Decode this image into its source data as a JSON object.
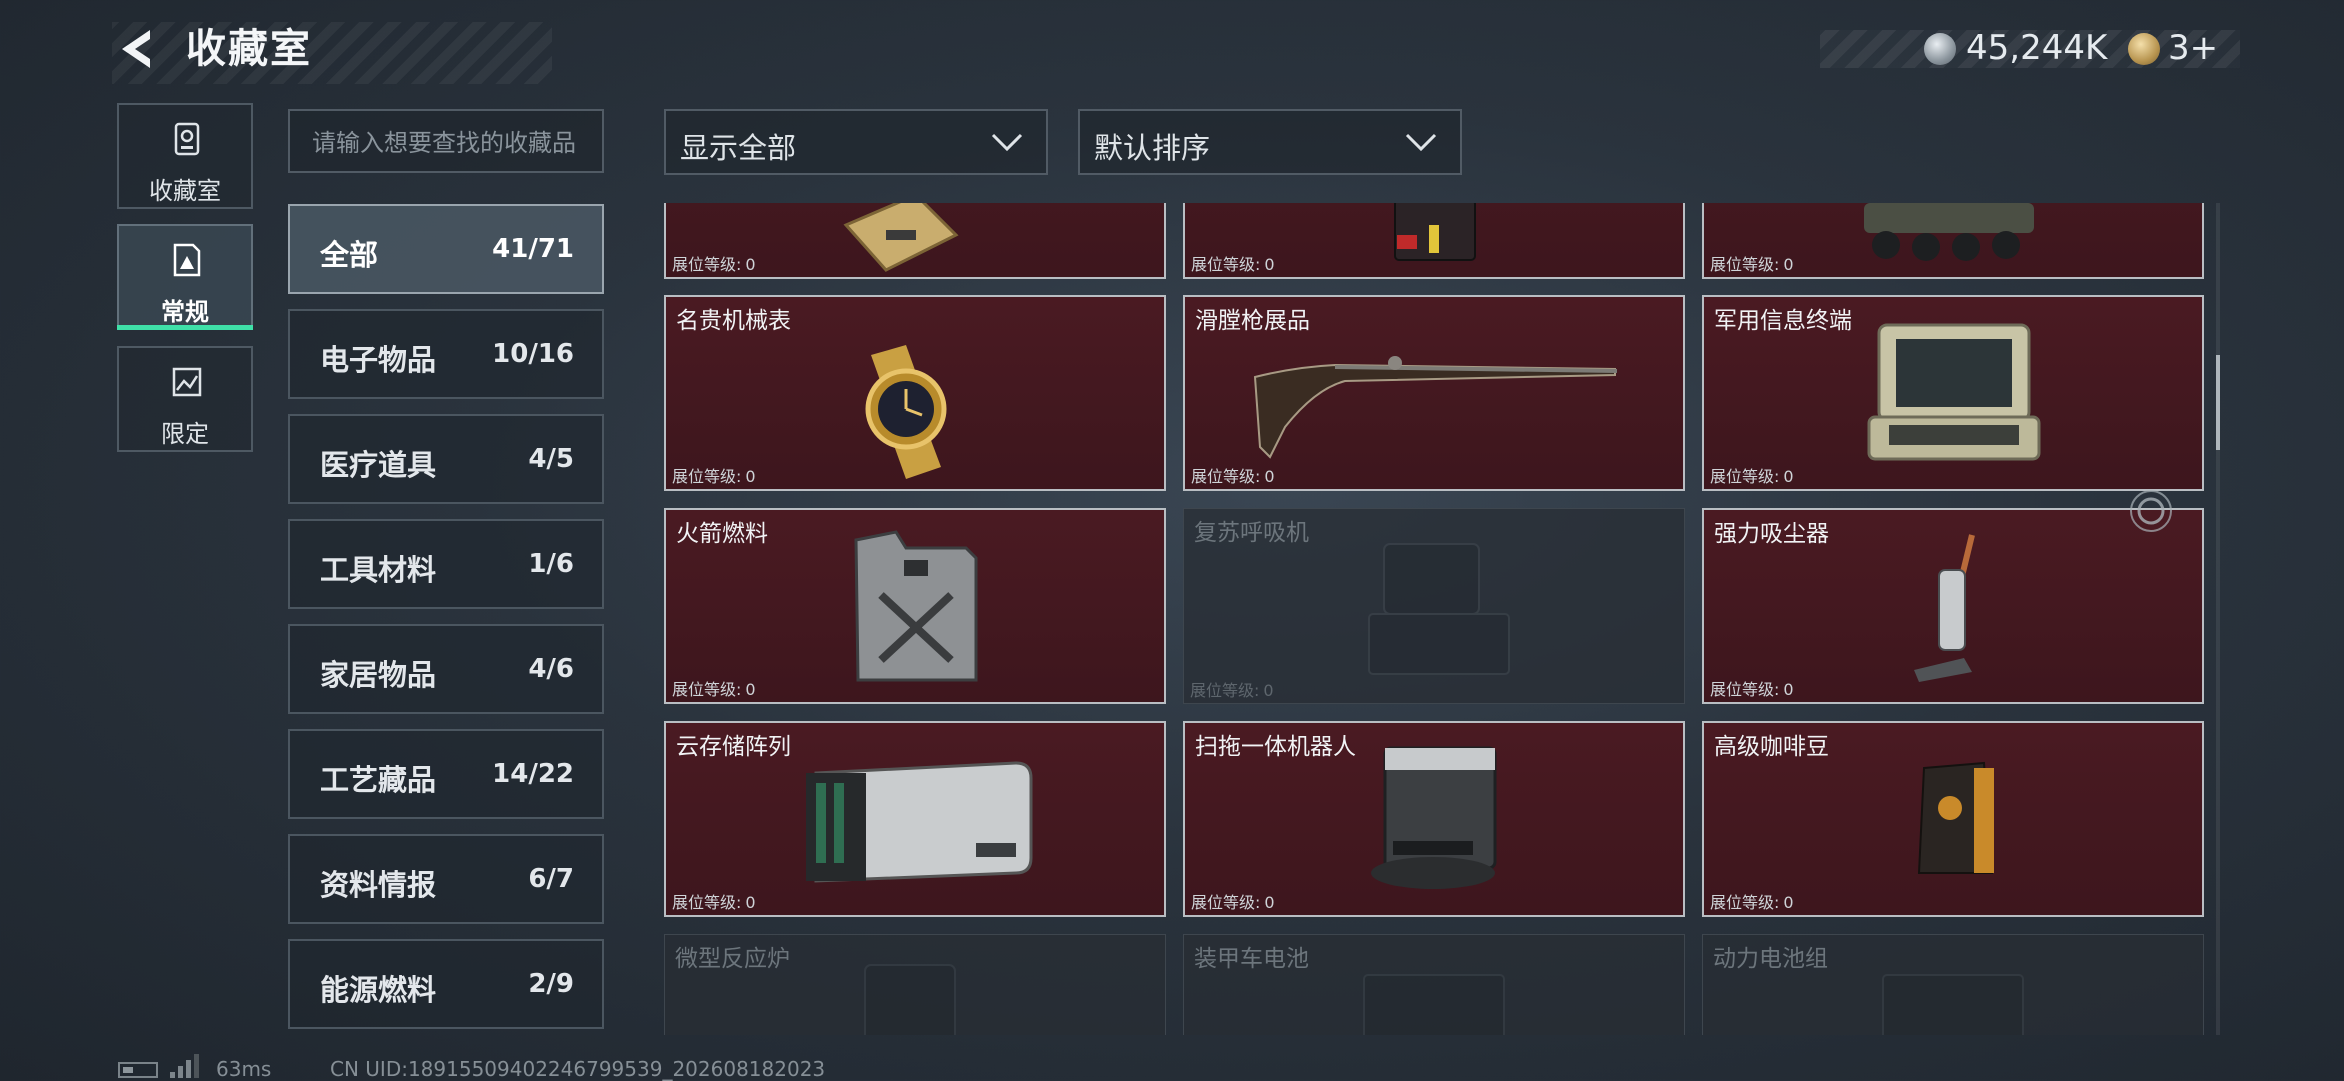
{
  "header": {
    "title": "收藏室",
    "currency": "45,244K",
    "tickets": "3+"
  },
  "side_tabs": [
    {
      "label": "收藏室",
      "icon": "vault-icon",
      "active": false
    },
    {
      "label": "常规",
      "icon": "regular-collection-icon",
      "active": true
    },
    {
      "label": "限定",
      "icon": "limited-collection-icon",
      "active": false
    }
  ],
  "search": {
    "placeholder": "请输入想要查找的收藏品",
    "value": ""
  },
  "filters": {
    "show": "显示全部",
    "sort": "默认排序"
  },
  "categories": [
    {
      "name": "全部",
      "count": "41/71",
      "active": true
    },
    {
      "name": "电子物品",
      "count": "10/16"
    },
    {
      "name": "医疗道具",
      "count": "4/5"
    },
    {
      "name": "工具材料",
      "count": "1/6"
    },
    {
      "name": "家居物品",
      "count": "4/6"
    },
    {
      "name": "工艺藏品",
      "count": "14/22"
    },
    {
      "name": "资料情报",
      "count": "6/7"
    },
    {
      "name": "能源燃料",
      "count": "2/9"
    }
  ],
  "level_label": "展位等级:",
  "items": [
    {
      "name": "",
      "level": "0",
      "locked": false,
      "icon": "gold-bar-icon"
    },
    {
      "name": "",
      "level": "0",
      "locked": false,
      "icon": "red-case-icon"
    },
    {
      "name": "",
      "level": "0",
      "locked": false,
      "icon": "armored-vehicle-icon"
    },
    {
      "name": "名贵机械表",
      "level": "0",
      "locked": false,
      "icon": "luxury-watch-icon"
    },
    {
      "name": "滑膛枪展品",
      "level": "0",
      "locked": false,
      "icon": "musket-icon"
    },
    {
      "name": "军用信息终端",
      "level": "0",
      "locked": false,
      "icon": "military-terminal-icon"
    },
    {
      "name": "火箭燃料",
      "level": "0",
      "locked": false,
      "icon": "fuel-can-icon"
    },
    {
      "name": "复苏呼吸机",
      "level": "0",
      "locked": true,
      "icon": "ventilator-icon"
    },
    {
      "name": "强力吸尘器",
      "level": "0",
      "locked": false,
      "icon": "vacuum-cleaner-icon"
    },
    {
      "name": "云存储阵列",
      "level": "0",
      "locked": false,
      "icon": "storage-array-icon"
    },
    {
      "name": "扫拖一体机器人",
      "level": "0",
      "locked": false,
      "icon": "robot-vacuum-icon"
    },
    {
      "name": "高级咖啡豆",
      "level": "0",
      "locked": false,
      "icon": "coffee-bag-icon"
    },
    {
      "name": "微型反应炉",
      "level": "",
      "locked": true,
      "icon": "micro-reactor-icon"
    },
    {
      "name": "装甲车电池",
      "level": "",
      "locked": true,
      "icon": "vehicle-battery-icon"
    },
    {
      "name": "动力电池组",
      "level": "",
      "locked": true,
      "icon": "power-battery-icon"
    }
  ],
  "footer": {
    "ping": "63ms",
    "uid": "CN UID:18915509402246799539_202608182023"
  }
}
